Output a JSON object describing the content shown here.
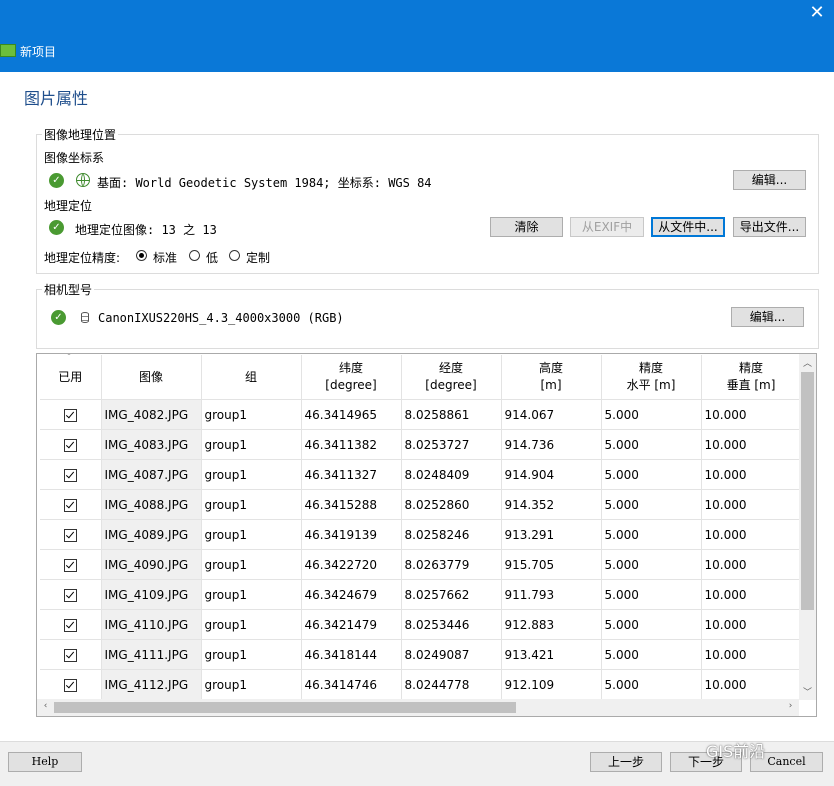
{
  "window": {
    "title": "新项目",
    "close_glyph": "✕"
  },
  "page": {
    "title": "图片属性"
  },
  "geo_section": {
    "legend": "图像地理位置",
    "crs_label": "图像坐标系",
    "crs_value": "基面: World Geodetic System 1984; 坐标系: WGS 84",
    "crs_edit": "编辑...",
    "geotag_label": "地理定位",
    "geotag_value": "地理定位图像: 13 之 13",
    "btn_clear": "清除",
    "btn_exif": "从EXIF中",
    "btn_from_file": "从文件中...",
    "btn_export": "导出文件...",
    "accuracy_label": "地理定位精度:",
    "accuracy_options": [
      "标准",
      "低",
      "定制"
    ],
    "accuracy_selected": "标准"
  },
  "camera_section": {
    "legend": "相机型号",
    "model": "CanonIXUS220HS_4.3_4000x3000 (RGB)",
    "edit": "编辑..."
  },
  "table": {
    "columns": [
      "已用",
      "图像",
      "组",
      "纬度\n[degree]",
      "经度\n[degree]",
      "高度\n[m]",
      "精度\n水平 [m]",
      "精度\n垂直 [m]"
    ],
    "rows": [
      {
        "enabled": true,
        "image": "IMG_4082.JPG",
        "group": "group1",
        "lat": "46.3414965",
        "lon": "8.0258861",
        "alt": "914.067",
        "acc_h": "5.000",
        "acc_v": "10.000"
      },
      {
        "enabled": true,
        "image": "IMG_4083.JPG",
        "group": "group1",
        "lat": "46.3411382",
        "lon": "8.0253727",
        "alt": "914.736",
        "acc_h": "5.000",
        "acc_v": "10.000"
      },
      {
        "enabled": true,
        "image": "IMG_4087.JPG",
        "group": "group1",
        "lat": "46.3411327",
        "lon": "8.0248409",
        "alt": "914.904",
        "acc_h": "5.000",
        "acc_v": "10.000"
      },
      {
        "enabled": true,
        "image": "IMG_4088.JPG",
        "group": "group1",
        "lat": "46.3415288",
        "lon": "8.0252860",
        "alt": "914.352",
        "acc_h": "5.000",
        "acc_v": "10.000"
      },
      {
        "enabled": true,
        "image": "IMG_4089.JPG",
        "group": "group1",
        "lat": "46.3419139",
        "lon": "8.0258246",
        "alt": "913.291",
        "acc_h": "5.000",
        "acc_v": "10.000"
      },
      {
        "enabled": true,
        "image": "IMG_4090.JPG",
        "group": "group1",
        "lat": "46.3422720",
        "lon": "8.0263779",
        "alt": "915.705",
        "acc_h": "5.000",
        "acc_v": "10.000"
      },
      {
        "enabled": true,
        "image": "IMG_4109.JPG",
        "group": "group1",
        "lat": "46.3424679",
        "lon": "8.0257662",
        "alt": "911.793",
        "acc_h": "5.000",
        "acc_v": "10.000"
      },
      {
        "enabled": true,
        "image": "IMG_4110.JPG",
        "group": "group1",
        "lat": "46.3421479",
        "lon": "8.0253446",
        "alt": "912.883",
        "acc_h": "5.000",
        "acc_v": "10.000"
      },
      {
        "enabled": true,
        "image": "IMG_4111.JPG",
        "group": "group1",
        "lat": "46.3418144",
        "lon": "8.0249087",
        "alt": "913.421",
        "acc_h": "5.000",
        "acc_v": "10.000"
      },
      {
        "enabled": true,
        "image": "IMG_4112.JPG",
        "group": "group1",
        "lat": "46.3414746",
        "lon": "8.0244778",
        "alt": "912.109",
        "acc_h": "5.000",
        "acc_v": "10.000"
      }
    ]
  },
  "footer": {
    "help": "Help",
    "back": "上一步",
    "next": "下一步",
    "cancel": "Cancel"
  },
  "watermark": "GIS前沿",
  "colors": {
    "titlebar": "#0a78d7",
    "page_title": "#1f4e8c",
    "ok_icon": "#4a9a32"
  },
  "icons": [
    "close-icon",
    "app-icon",
    "check-ok-icon",
    "globe-icon",
    "database-icon",
    "chevron-down-icon",
    "checkbox-icon",
    "scroll-arrow-icon"
  ]
}
